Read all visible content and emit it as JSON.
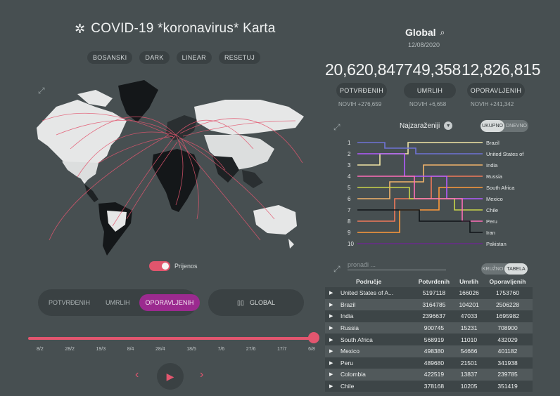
{
  "header": {
    "title": "COVID-19 *koronavirus* Karta",
    "buttons": [
      "BOSANSKI",
      "DARK",
      "LINEAR",
      "RESETUJ"
    ]
  },
  "map": {
    "toggle_label": "Prijenos"
  },
  "metric_tabs": [
    "POTVRĐENIH",
    "UMRLIH",
    "OPORAVLJENIH"
  ],
  "global_button": "GLOBAL",
  "timeline": {
    "ticks": [
      "8/2",
      "28/2",
      "19/3",
      "8/4",
      "28/4",
      "18/5",
      "7/6",
      "27/6",
      "17/7",
      "6/8"
    ],
    "progress": 1.0
  },
  "summary": {
    "title": "Global",
    "date": "12/08/2020",
    "confirmed": "20,620,847",
    "deaths": "749,358",
    "recovered": "12,826,815",
    "confirmed_label": "POTVRĐENIH",
    "deaths_label": "UMRLIH",
    "recovered_label": "OPORAVLJENIH",
    "confirmed_new": "NOVIH +276,659",
    "deaths_new": "NOVIH +6,658",
    "recovered_new": "NOVIH +241,342"
  },
  "ranking": {
    "title": "Najzaraženiji",
    "switch": [
      "UKUPNO",
      "DNEVNO"
    ],
    "ranks": [
      "1",
      "2",
      "3",
      "4",
      "5",
      "6",
      "7",
      "8",
      "9",
      "10"
    ],
    "countries": [
      "Brazil",
      "United States of",
      "India",
      "Russia",
      "South Africa",
      "Mexico",
      "Chile",
      "Peru",
      "Iran",
      "Pakistan"
    ],
    "colors": [
      "#f2e6a6",
      "#6f73d6",
      "#f2b46b",
      "#f07a5a",
      "#ff9a3a",
      "#b45cff",
      "#c8d44a",
      "#ff6fb8",
      "#101418",
      "#6a2a8c"
    ]
  },
  "table": {
    "search_placeholder": "pronađi ...",
    "switch": [
      "KRUŽNO",
      "TABELA"
    ],
    "headers": [
      "Područje",
      "Potvrđenih",
      "Umrlih",
      "Oporavljenih"
    ],
    "rows": [
      [
        "United States of A...",
        "5197118",
        "166026",
        "1753760"
      ],
      [
        "Brazil",
        "3164785",
        "104201",
        "2506228"
      ],
      [
        "India",
        "2396637",
        "47033",
        "1695982"
      ],
      [
        "Russia",
        "900745",
        "15231",
        "708900"
      ],
      [
        "South Africa",
        "568919",
        "11010",
        "432029"
      ],
      [
        "Mexico",
        "498380",
        "54666",
        "401182"
      ],
      [
        "Peru",
        "489680",
        "21501",
        "341938"
      ],
      [
        "Colombia",
        "422519",
        "13837",
        "239785"
      ],
      [
        "Chile",
        "378168",
        "10205",
        "351419"
      ]
    ]
  }
}
